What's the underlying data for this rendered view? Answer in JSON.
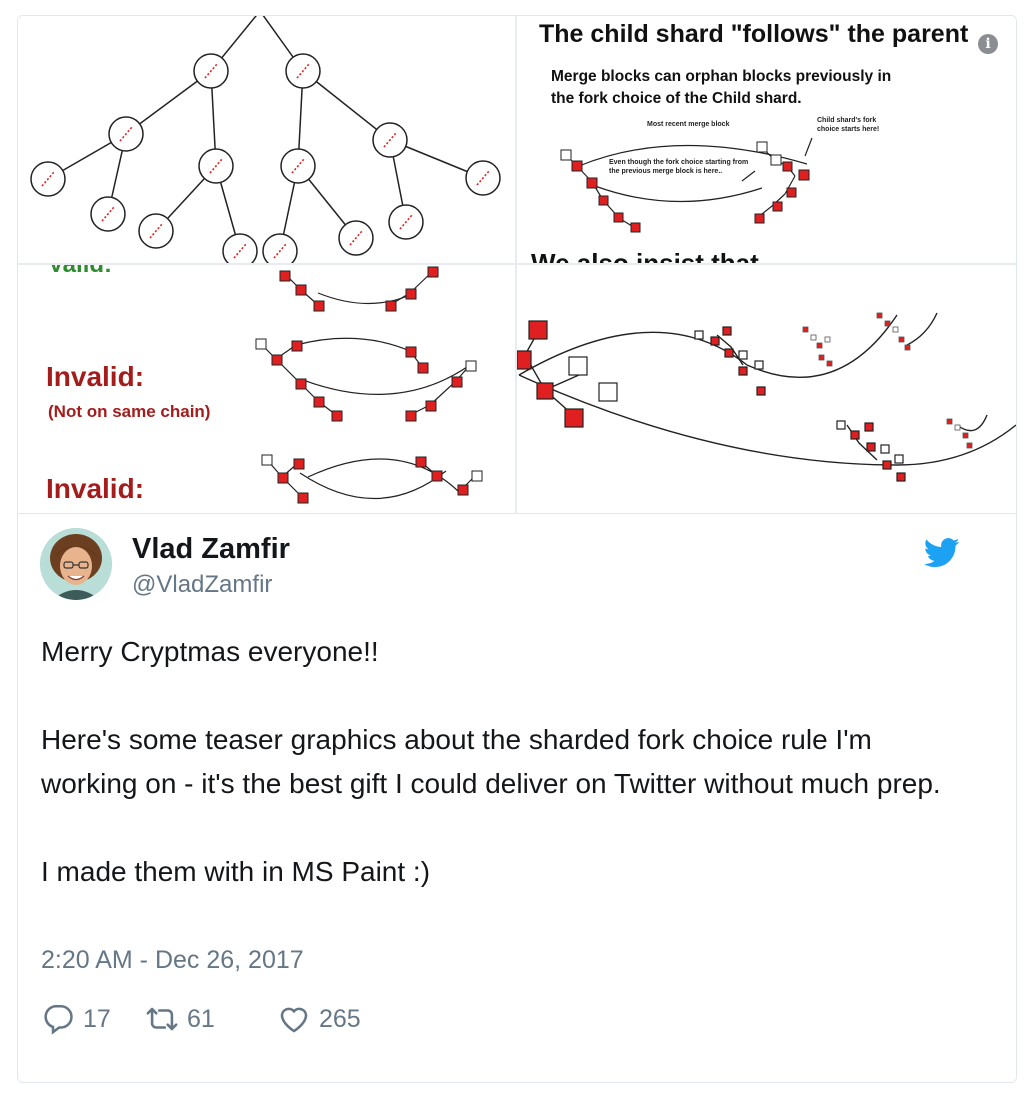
{
  "media": {
    "tile2": {
      "title": "The child shard \"follows\" the parent",
      "subtitle": "Merge blocks can orphan blocks previously in the fork choice of the Child shard.",
      "label_recent": "Most recent merge block",
      "label_child": "Child shard's fork choice starts here!",
      "label_even": "Even though the fork choice starting from the previous merge block is here..",
      "cut_text": "We also insist that"
    },
    "tile3": {
      "valid_label": "Valid:",
      "invalid_label_1": "Invalid:",
      "invalid_note": "(Not on same chain)",
      "invalid_label_2": "Invalid:"
    },
    "info_icon": "info-icon"
  },
  "author": {
    "name": "Vlad Zamfir",
    "handle": "@VladZamfir"
  },
  "tweet": {
    "line1": "Merry Cryptmas everyone!!",
    "line2": "Here's some teaser graphics about the sharded fork choice rule I'm working on - it's the best gift I could deliver on Twitter without much prep.",
    "line3": "I made them with in MS Paint :)",
    "timestamp": "2:20 AM - Dec 26, 2017"
  },
  "actions": {
    "replies": "17",
    "retweets": "61",
    "likes": "265"
  },
  "colors": {
    "twitter_blue": "#1da1f2",
    "block_red": "#e02020",
    "valid_green": "#2e8b2e",
    "invalid_red": "#a51c1c",
    "secondary_text": "#657786"
  }
}
